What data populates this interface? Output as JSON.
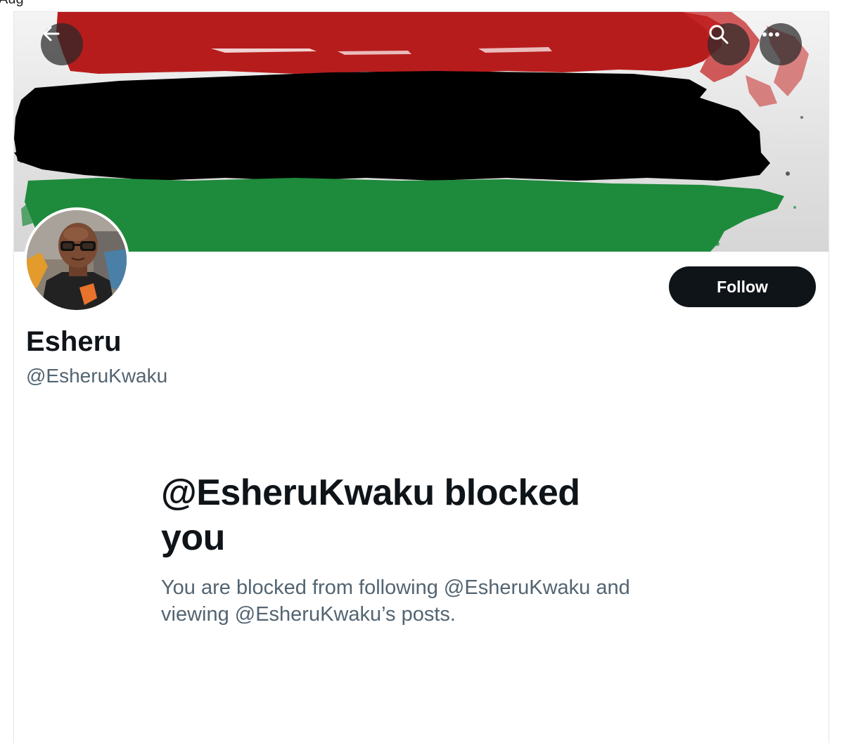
{
  "top_crop_text": "Aug",
  "header": {
    "back_icon": "arrow-left-icon",
    "search_icon": "search-icon",
    "more_icon": "more-horizontal-icon"
  },
  "banner": {
    "description_colors": [
      "#b71c1c",
      "#000000",
      "#1e8a3c"
    ]
  },
  "profile": {
    "display_name": "Esheru",
    "handle": "@EsheruKwaku",
    "follow_label": "Follow"
  },
  "blocked": {
    "title": "@EsheruKwaku blocked you",
    "description": "You are blocked from following @EsheruKwaku and viewing @EsheruKwaku’s posts."
  },
  "colors": {
    "follow_bg": "#0f1419",
    "secondary_text": "#536471",
    "primary_text": "#0f1419"
  }
}
